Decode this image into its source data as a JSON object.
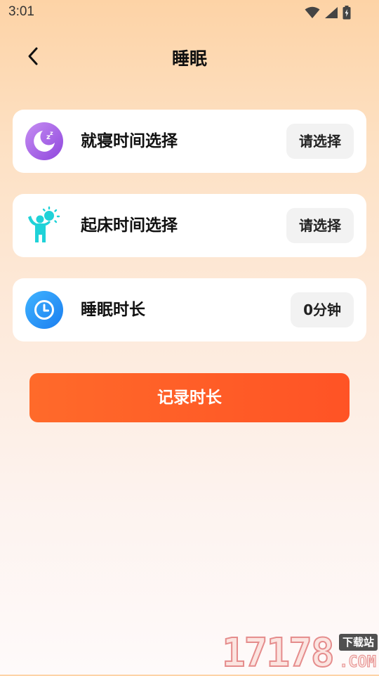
{
  "status_bar": {
    "time": "3:01",
    "icons": [
      "wifi-icon",
      "signal-icon",
      "battery-icon"
    ]
  },
  "header": {
    "title": "睡眠",
    "back_icon": "chevron-left-icon"
  },
  "cards": [
    {
      "icon": "moon-sleep-icon",
      "label": "就寝时间选择",
      "value": "请选择"
    },
    {
      "icon": "wake-up-sun-icon",
      "label": "起床时间选择",
      "value": "请选择"
    },
    {
      "icon": "clock-icon",
      "label": "睡眠时长",
      "value": "0分钟"
    }
  ],
  "record_button": {
    "label": "记录时长"
  },
  "watermark": {
    "digits": "17178",
    "badge": "下载站",
    "suffix": ".COM"
  },
  "colors": {
    "accent": "#ff5a27",
    "moon_purple": "#a25ee6",
    "wake_cyan": "#1fd2d8",
    "clock_blue": "#1e9af7"
  }
}
